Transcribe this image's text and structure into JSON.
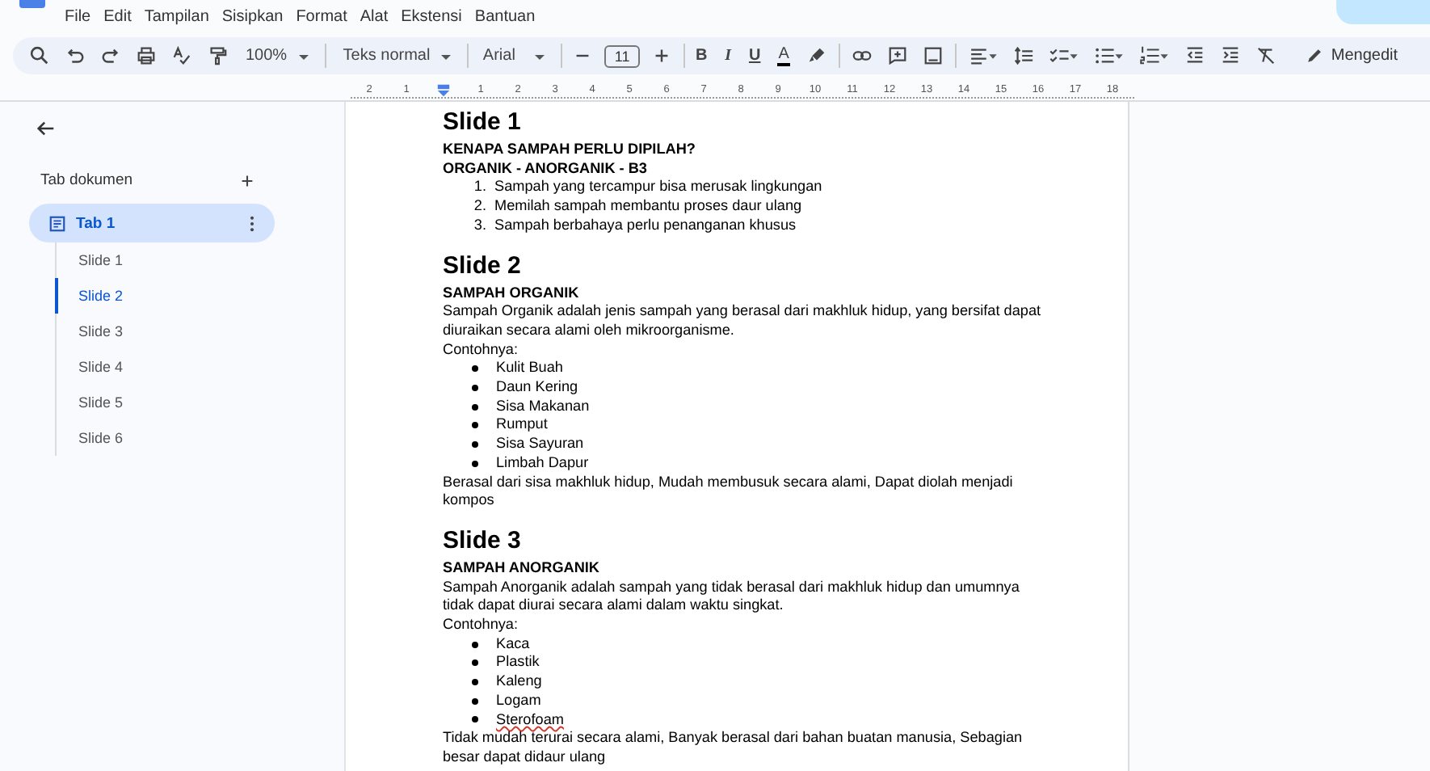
{
  "menu": [
    "File",
    "Edit",
    "Tampilan",
    "Sisipkan",
    "Format",
    "Alat",
    "Ekstensi",
    "Bantuan"
  ],
  "toolbar": {
    "zoom": "100%",
    "style": "Teks normal",
    "font": "Arial",
    "font_size": "11",
    "format_letters": [
      "B",
      "I",
      "U"
    ],
    "text_color_letter": "A",
    "mode": "Mengedit"
  },
  "ruler": {
    "left_labels": [
      "2",
      "1"
    ],
    "labels": [
      "1",
      "2",
      "3",
      "4",
      "5",
      "6",
      "7",
      "8",
      "9",
      "10",
      "11",
      "12",
      "13",
      "14",
      "15",
      "16",
      "17",
      "18"
    ]
  },
  "sidebar": {
    "title": "Tab dokumen",
    "tab": {
      "label": "Tab 1",
      "selected": true
    },
    "items": [
      {
        "label": "Slide 1",
        "selected": false
      },
      {
        "label": "Slide 2",
        "selected": true
      },
      {
        "label": "Slide 3",
        "selected": false
      },
      {
        "label": "Slide 4",
        "selected": false
      },
      {
        "label": "Slide 5",
        "selected": false
      },
      {
        "label": "Slide 6",
        "selected": false
      }
    ]
  },
  "document": [
    {
      "kind": "heading",
      "text": "Slide 1"
    },
    {
      "kind": "subheading",
      "text": "KENAPA SAMPAH PERLU DIPILAH?"
    },
    {
      "kind": "subheading",
      "text": "ORGANIK - ANORGANIK - B3"
    },
    {
      "kind": "numbered_list",
      "items": [
        {
          "number": "1.",
          "text": "Sampah yang tercampur bisa merusak lingkungan",
          "misspelled": false
        },
        {
          "number": "2.",
          "text": "Memilah sampah membantu proses daur ulang",
          "misspelled": false
        },
        {
          "number": "3.",
          "text": "Sampah berbahaya perlu penanganan khusus",
          "misspelled": false
        }
      ]
    },
    {
      "kind": "heading",
      "text": "Slide 2"
    },
    {
      "kind": "subheading",
      "text": "SAMPAH ORGANIK"
    },
    {
      "kind": "paragraph",
      "text": "Sampah Organik adalah jenis sampah yang berasal dari makhluk hidup, yang bersifat dapat diuraikan secara alami oleh mikroorganisme."
    },
    {
      "kind": "paragraph",
      "text": "Contohnya:"
    },
    {
      "kind": "bullet_list",
      "items": [
        {
          "text": "Kulit Buah",
          "misspelled": false
        },
        {
          "text": "Daun Kering",
          "misspelled": false
        },
        {
          "text": "Sisa Makanan",
          "misspelled": false
        },
        {
          "text": "Rumput",
          "misspelled": false
        },
        {
          "text": "Sisa Sayuran",
          "misspelled": false
        },
        {
          "text": "Limbah Dapur",
          "misspelled": false
        }
      ]
    },
    {
      "kind": "paragraph",
      "text": "Berasal dari sisa makhluk hidup, Mudah membusuk secara alami, Dapat diolah menjadi kompos"
    },
    {
      "kind": "heading",
      "text": "Slide 3"
    },
    {
      "kind": "subheading",
      "text": "SAMPAH ANORGANIK"
    },
    {
      "kind": "paragraph",
      "text": "Sampah Anorganik adalah sampah yang tidak berasal dari makhluk hidup dan umumnya tidak dapat diurai secara alami dalam waktu singkat."
    },
    {
      "kind": "paragraph",
      "text": "Contohnya:"
    },
    {
      "kind": "bullet_list",
      "items": [
        {
          "text": "Kaca",
          "misspelled": false
        },
        {
          "text": "Plastik",
          "misspelled": false
        },
        {
          "text": "Kaleng",
          "misspelled": false
        },
        {
          "text": "Logam",
          "misspelled": false
        },
        {
          "text": "Sterofoam",
          "misspelled": true
        }
      ]
    },
    {
      "kind": "paragraph",
      "text": "Tidak mudah terurai secara alami, Banyak berasal dari bahan buatan manusia, Sebagian besar dapat didaur ulang"
    }
  ]
}
